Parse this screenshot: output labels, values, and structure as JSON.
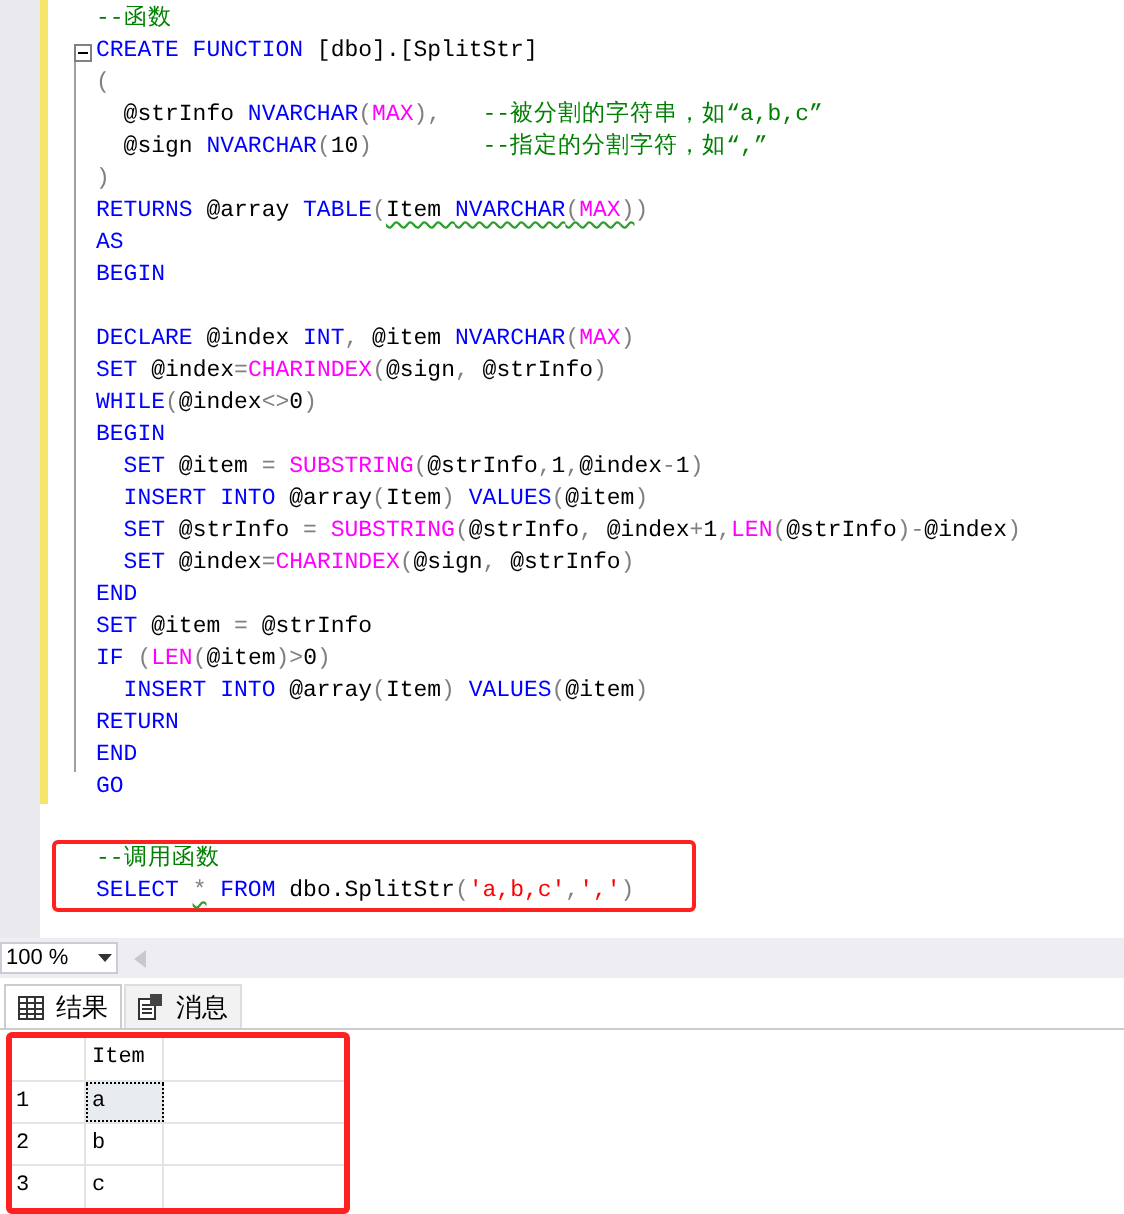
{
  "editor": {
    "lines": [
      {
        "kind": "code",
        "tokens": [
          {
            "text": "--函数",
            "color": "#008000"
          }
        ]
      },
      {
        "kind": "code",
        "fold": true,
        "tokens": [
          {
            "text": "CREATE FUNCTION",
            "color": "#0000ff"
          },
          {
            "text": " [dbo].[SplitStr]",
            "color": "#000000"
          }
        ]
      },
      {
        "kind": "code",
        "tokens": [
          {
            "text": "(",
            "color": "#808080"
          }
        ]
      },
      {
        "kind": "code",
        "tokens": [
          {
            "text": "  @strInfo ",
            "color": "#000000"
          },
          {
            "text": "NVARCHAR",
            "color": "#0000ff"
          },
          {
            "text": "(",
            "color": "#808080"
          },
          {
            "text": "MAX",
            "color": "#ff00ff"
          },
          {
            "text": "),",
            "color": "#808080"
          },
          {
            "text": "   --被分割的字符串，如“a,b,c”",
            "color": "#008000"
          }
        ]
      },
      {
        "kind": "code",
        "tokens": [
          {
            "text": "  @sign ",
            "color": "#000000"
          },
          {
            "text": "NVARCHAR",
            "color": "#0000ff"
          },
          {
            "text": "(",
            "color": "#808080"
          },
          {
            "text": "10",
            "color": "#000000"
          },
          {
            "text": ")",
            "color": "#808080"
          },
          {
            "text": "        --指定的分割字符，如“,”",
            "color": "#008000"
          }
        ]
      },
      {
        "kind": "code",
        "tokens": [
          {
            "text": ")",
            "color": "#808080"
          }
        ]
      },
      {
        "kind": "code",
        "tokens": [
          {
            "text": "RETURNS",
            "color": "#0000ff"
          },
          {
            "text": " @array ",
            "color": "#000000"
          },
          {
            "text": "TABLE",
            "color": "#0000ff"
          },
          {
            "text": "(",
            "color": "#808080"
          },
          {
            "text": "Item ",
            "color": "#000000",
            "squiggle": true
          },
          {
            "text": "NVARCHAR",
            "color": "#0000ff",
            "squiggle": true
          },
          {
            "text": "(",
            "color": "#808080",
            "squiggle": true
          },
          {
            "text": "MAX",
            "color": "#ff00ff",
            "squiggle": true
          },
          {
            "text": ")",
            "color": "#808080",
            "squiggle": true
          },
          {
            "text": ")",
            "color": "#808080"
          }
        ]
      },
      {
        "kind": "code",
        "tokens": [
          {
            "text": "AS",
            "color": "#0000ff"
          }
        ]
      },
      {
        "kind": "code",
        "tokens": [
          {
            "text": "BEGIN",
            "color": "#0000ff"
          }
        ]
      },
      {
        "kind": "blank"
      },
      {
        "kind": "code",
        "tokens": [
          {
            "text": "DECLARE",
            "color": "#0000ff"
          },
          {
            "text": " @index ",
            "color": "#000000"
          },
          {
            "text": "INT",
            "color": "#0000ff"
          },
          {
            "text": ",",
            "color": "#808080"
          },
          {
            "text": " @item ",
            "color": "#000000"
          },
          {
            "text": "NVARCHAR",
            "color": "#0000ff"
          },
          {
            "text": "(",
            "color": "#808080"
          },
          {
            "text": "MAX",
            "color": "#ff00ff"
          },
          {
            "text": ")",
            "color": "#808080"
          }
        ]
      },
      {
        "kind": "code",
        "tokens": [
          {
            "text": "SET",
            "color": "#0000ff"
          },
          {
            "text": " @index",
            "color": "#000000"
          },
          {
            "text": "=",
            "color": "#808080"
          },
          {
            "text": "CHARINDEX",
            "color": "#ff00ff"
          },
          {
            "text": "(",
            "color": "#808080"
          },
          {
            "text": "@sign",
            "color": "#000000"
          },
          {
            "text": ",",
            "color": "#808080"
          },
          {
            "text": " @strInfo",
            "color": "#000000"
          },
          {
            "text": ")",
            "color": "#808080"
          }
        ]
      },
      {
        "kind": "code",
        "tokens": [
          {
            "text": "WHILE",
            "color": "#0000ff"
          },
          {
            "text": "(",
            "color": "#808080"
          },
          {
            "text": "@index",
            "color": "#000000"
          },
          {
            "text": "<>",
            "color": "#808080"
          },
          {
            "text": "0",
            "color": "#000000"
          },
          {
            "text": ")",
            "color": "#808080"
          }
        ]
      },
      {
        "kind": "code",
        "tokens": [
          {
            "text": "BEGIN",
            "color": "#0000ff"
          }
        ]
      },
      {
        "kind": "code",
        "tokens": [
          {
            "text": "  SET",
            "color": "#0000ff"
          },
          {
            "text": " @item ",
            "color": "#000000"
          },
          {
            "text": "=",
            "color": "#808080"
          },
          {
            "text": " SUBSTRING",
            "color": "#ff00ff"
          },
          {
            "text": "(",
            "color": "#808080"
          },
          {
            "text": "@strInfo",
            "color": "#000000"
          },
          {
            "text": ",",
            "color": "#808080"
          },
          {
            "text": "1",
            "color": "#000000"
          },
          {
            "text": ",",
            "color": "#808080"
          },
          {
            "text": "@index",
            "color": "#000000"
          },
          {
            "text": "-",
            "color": "#808080"
          },
          {
            "text": "1",
            "color": "#000000"
          },
          {
            "text": ")",
            "color": "#808080"
          }
        ]
      },
      {
        "kind": "code",
        "tokens": [
          {
            "text": "  INSERT INTO",
            "color": "#0000ff"
          },
          {
            "text": " @array",
            "color": "#000000"
          },
          {
            "text": "(",
            "color": "#808080"
          },
          {
            "text": "Item",
            "color": "#000000"
          },
          {
            "text": ")",
            "color": "#808080"
          },
          {
            "text": " VALUES",
            "color": "#0000ff"
          },
          {
            "text": "(",
            "color": "#808080"
          },
          {
            "text": "@item",
            "color": "#000000"
          },
          {
            "text": ")",
            "color": "#808080"
          }
        ]
      },
      {
        "kind": "code",
        "tokens": [
          {
            "text": "  SET",
            "color": "#0000ff"
          },
          {
            "text": " @strInfo ",
            "color": "#000000"
          },
          {
            "text": "=",
            "color": "#808080"
          },
          {
            "text": " SUBSTRING",
            "color": "#ff00ff"
          },
          {
            "text": "(",
            "color": "#808080"
          },
          {
            "text": "@strInfo",
            "color": "#000000"
          },
          {
            "text": ",",
            "color": "#808080"
          },
          {
            "text": " @index",
            "color": "#000000"
          },
          {
            "text": "+",
            "color": "#808080"
          },
          {
            "text": "1",
            "color": "#000000"
          },
          {
            "text": ",",
            "color": "#808080"
          },
          {
            "text": "LEN",
            "color": "#ff00ff"
          },
          {
            "text": "(",
            "color": "#808080"
          },
          {
            "text": "@strInfo",
            "color": "#000000"
          },
          {
            "text": ")-",
            "color": "#808080"
          },
          {
            "text": "@index",
            "color": "#000000"
          },
          {
            "text": ")",
            "color": "#808080"
          }
        ]
      },
      {
        "kind": "code",
        "tokens": [
          {
            "text": "  SET",
            "color": "#0000ff"
          },
          {
            "text": " @index",
            "color": "#000000"
          },
          {
            "text": "=",
            "color": "#808080"
          },
          {
            "text": "CHARINDEX",
            "color": "#ff00ff"
          },
          {
            "text": "(",
            "color": "#808080"
          },
          {
            "text": "@sign",
            "color": "#000000"
          },
          {
            "text": ",",
            "color": "#808080"
          },
          {
            "text": " @strInfo",
            "color": "#000000"
          },
          {
            "text": ")",
            "color": "#808080"
          }
        ]
      },
      {
        "kind": "code",
        "tokens": [
          {
            "text": "END",
            "color": "#0000ff"
          }
        ]
      },
      {
        "kind": "code",
        "tokens": [
          {
            "text": "SET",
            "color": "#0000ff"
          },
          {
            "text": " @item ",
            "color": "#000000"
          },
          {
            "text": "=",
            "color": "#808080"
          },
          {
            "text": " @strInfo",
            "color": "#000000"
          }
        ]
      },
      {
        "kind": "code",
        "tokens": [
          {
            "text": "IF",
            "color": "#0000ff"
          },
          {
            "text": " (",
            "color": "#808080"
          },
          {
            "text": "LEN",
            "color": "#ff00ff"
          },
          {
            "text": "(",
            "color": "#808080"
          },
          {
            "text": "@item",
            "color": "#000000"
          },
          {
            "text": ")>",
            "color": "#808080"
          },
          {
            "text": "0",
            "color": "#000000"
          },
          {
            "text": ")",
            "color": "#808080"
          }
        ]
      },
      {
        "kind": "code",
        "tokens": [
          {
            "text": "  INSERT INTO",
            "color": "#0000ff"
          },
          {
            "text": " @array",
            "color": "#000000"
          },
          {
            "text": "(",
            "color": "#808080"
          },
          {
            "text": "Item",
            "color": "#000000"
          },
          {
            "text": ")",
            "color": "#808080"
          },
          {
            "text": " VALUES",
            "color": "#0000ff"
          },
          {
            "text": "(",
            "color": "#808080"
          },
          {
            "text": "@item",
            "color": "#000000"
          },
          {
            "text": ")",
            "color": "#808080"
          }
        ]
      },
      {
        "kind": "code",
        "tokens": [
          {
            "text": "RETURN",
            "color": "#0000ff"
          }
        ]
      },
      {
        "kind": "code",
        "tokens": [
          {
            "text": "END",
            "color": "#0000ff"
          }
        ]
      },
      {
        "kind": "code",
        "tokens": [
          {
            "text": "GO",
            "color": "#0000ff"
          }
        ]
      },
      {
        "kind": "blank"
      },
      {
        "kind": "code",
        "tokens": [
          {
            "text": "--调用函数",
            "color": "#008000"
          }
        ]
      },
      {
        "kind": "code",
        "tokens": [
          {
            "text": "SELECT ",
            "color": "#0000ff"
          },
          {
            "text": "*",
            "color": "#808080",
            "squiggle": true
          },
          {
            "text": " FROM",
            "color": "#0000ff"
          },
          {
            "text": " dbo.SplitStr",
            "color": "#000000"
          },
          {
            "text": "(",
            "color": "#808080"
          },
          {
            "text": "'a,b,c'",
            "color": "#ff0000"
          },
          {
            "text": ",",
            "color": "#808080"
          },
          {
            "text": "','",
            "color": "#ff0000"
          },
          {
            "text": ")",
            "color": "#808080"
          }
        ]
      }
    ]
  },
  "zoom": {
    "value": "100 %"
  },
  "tabs": [
    {
      "label": "结果",
      "selected": true,
      "kind": "grid"
    },
    {
      "label": "消息",
      "selected": false,
      "kind": "messages"
    }
  ],
  "results": {
    "columns": [
      "Item"
    ],
    "rows": [
      {
        "number": "1",
        "cells": [
          "a"
        ],
        "selected": true
      },
      {
        "number": "2",
        "cells": [
          "b"
        ],
        "selected": false
      },
      {
        "number": "3",
        "cells": [
          "c"
        ],
        "selected": false
      }
    ]
  }
}
